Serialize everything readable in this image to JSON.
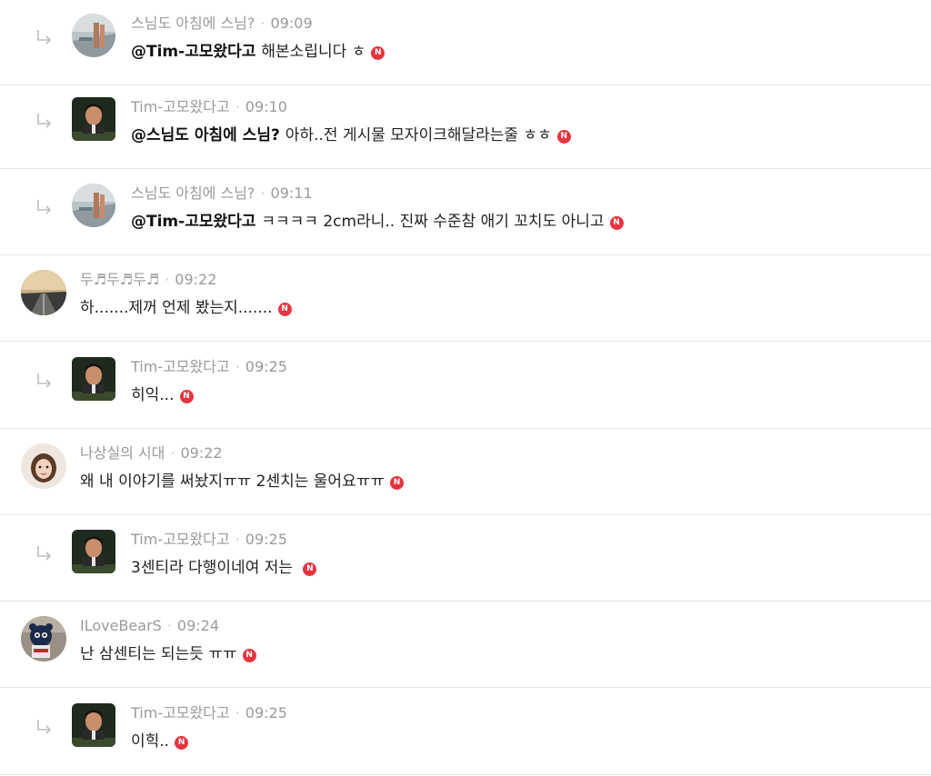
{
  "comments": [
    {
      "author": "스님도 아침에 스님?",
      "time": "09:09",
      "mention": "@Tim-고모왔다고",
      "text": "해본소립니다 ㅎ",
      "new_badge": "N"
    },
    {
      "author": "Tim-고모왔다고",
      "time": "09:10",
      "mention": "@스님도 아침에 스님?",
      "text": "아하..전 게시물 모자이크해달라는줄 ㅎㅎ",
      "new_badge": "N"
    },
    {
      "author": "스님도 아침에 스님?",
      "time": "09:11",
      "mention": "@Tim-고모왔다고",
      "text": "ㅋㅋㅋㅋ 2cm라니.. 진짜 수준참 애기 꼬치도 아니고",
      "new_badge": "N"
    },
    {
      "author": "두♬두♬두♬",
      "time": "09:22",
      "text": "하.......제꺼 언제 봤는지.......",
      "new_badge": "N"
    },
    {
      "author": "Tim-고모왔다고",
      "time": "09:25",
      "text": "히익...",
      "new_badge": "N"
    },
    {
      "author": "나상실의 시대",
      "time": "09:22",
      "text": "왜 내 이야기를 써놨지ㅠㅠ 2센치는 울어요ㅠㅠ",
      "new_badge": "N"
    },
    {
      "author": "Tim-고모왔다고",
      "time": "09:25",
      "text": "3센티라 다행이네여 저는 ",
      "new_badge": "N"
    },
    {
      "author": "ILoveBearS",
      "time": "09:24",
      "text": "난 삼센티는 되는듯 ㅠㅠ",
      "new_badge": "N"
    },
    {
      "author": "Tim-고모왔다고",
      "time": "09:25",
      "text": "이힉..",
      "new_badge": "N"
    }
  ],
  "meta_separator": "·",
  "colors": {
    "new_badge": "#e8343f",
    "meta_text": "#9a9a9a",
    "body_text": "#222222",
    "divider": "#e6e6e6"
  },
  "icons": {
    "reply": "reply-arrow-icon",
    "new": "new-badge-icon"
  }
}
